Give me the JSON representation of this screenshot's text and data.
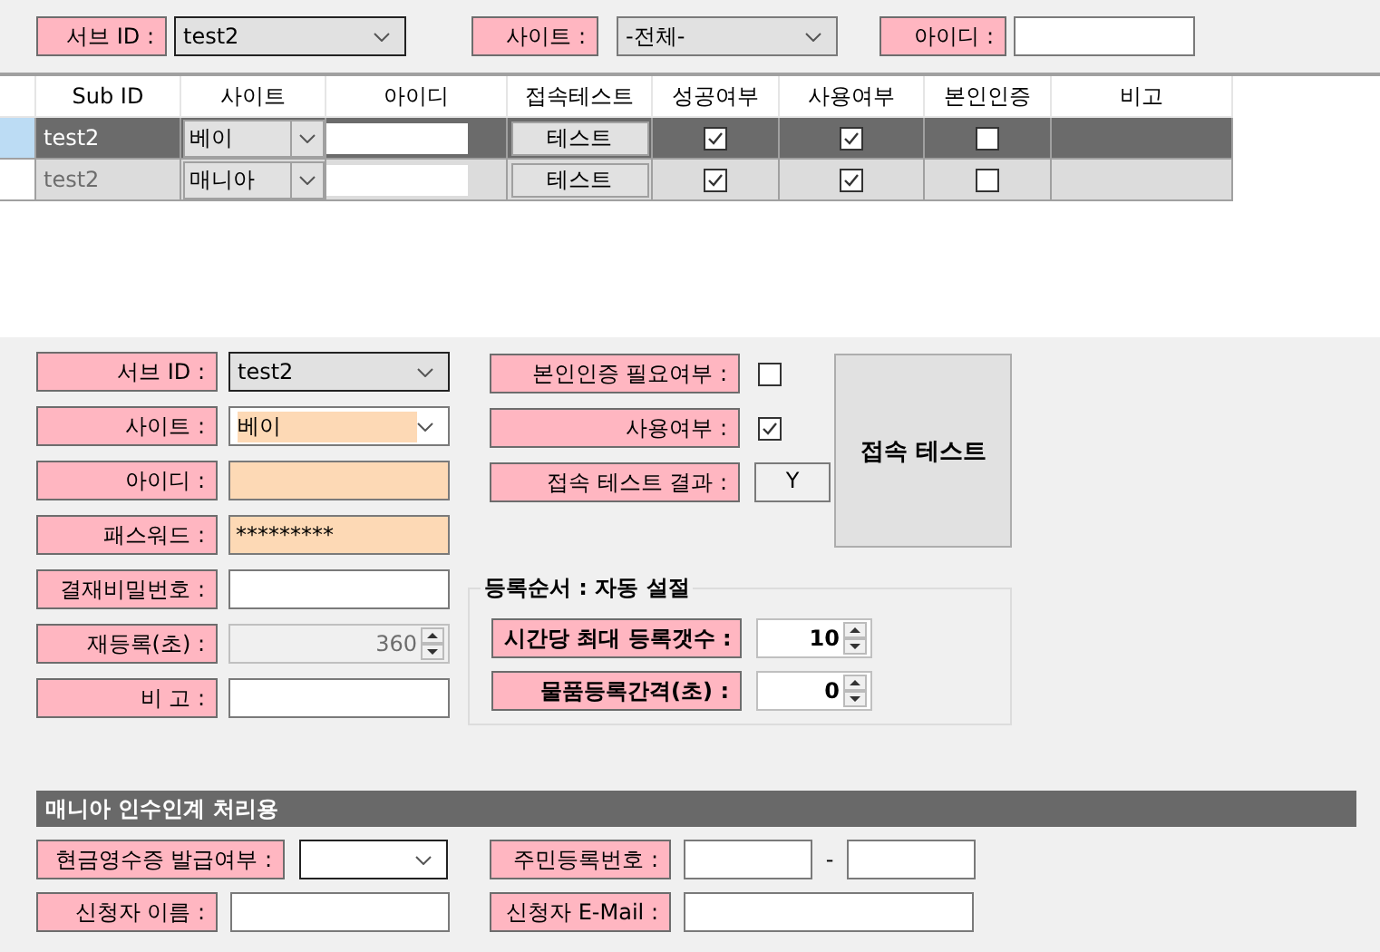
{
  "filter": {
    "sub_id": {
      "label": "서브 ID :",
      "value": "test2"
    },
    "site": {
      "label": "사이트 :",
      "value": "-전체-"
    },
    "user_id": {
      "label": "아이디 :"
    }
  },
  "grid": {
    "columns": [
      "Sub ID",
      "사이트",
      "아이디",
      "접속테스트",
      "성공여부",
      "사용여부",
      "본인인증",
      "비고"
    ],
    "rows": [
      {
        "sub_id": "test2",
        "site": "베이",
        "test_button": "테스트",
        "success": true,
        "in_use": true,
        "verified": false,
        "selected": true
      },
      {
        "sub_id": "test2",
        "site": "매니아",
        "test_button": "테스트",
        "success": true,
        "in_use": true,
        "verified": false,
        "selected": false
      }
    ]
  },
  "form": {
    "left": [
      {
        "label": "서브 ID :",
        "kind": "dropdown",
        "value": "test2",
        "highlight": false
      },
      {
        "label": "사이트 :",
        "kind": "combo",
        "value": "베이",
        "highlight": true
      },
      {
        "label": "아이디 :",
        "kind": "text",
        "highlight": true
      },
      {
        "label": "패스워드 :",
        "kind": "text",
        "value": "*********",
        "highlight": true
      },
      {
        "label": "결재비밀번호 :",
        "kind": "text",
        "highlight": false
      },
      {
        "label": "재등록(초) :",
        "kind": "spin",
        "value": "360",
        "highlight": false
      },
      {
        "label": "비 고 :",
        "kind": "text",
        "highlight": false
      }
    ],
    "middle": [
      {
        "label": "본인인증 필요여부 :",
        "kind": "checkbox",
        "checked": false
      },
      {
        "label": "사용여부 :",
        "kind": "checkbox",
        "checked": true
      },
      {
        "label": "접속 테스트 결과 :",
        "kind": "result",
        "value": "Y"
      }
    ],
    "connect_button": "접속 테스트",
    "group": {
      "title": "등록순서 : 자동 설절",
      "items": [
        {
          "label": "시간당 최대 등록갯수 :",
          "value": "10"
        },
        {
          "label": "물품등록간격(초) :",
          "value": "0"
        }
      ]
    }
  },
  "handover": {
    "title": "매니아 인수인계 처리용",
    "receipt": {
      "label": "현금영수증 발급여부 :"
    },
    "resident_no": {
      "label": "주민등록번호 :",
      "separator": "-"
    },
    "name": {
      "label": "신청자 이름 :"
    },
    "email": {
      "label": "신청자 E-Mail :"
    }
  }
}
